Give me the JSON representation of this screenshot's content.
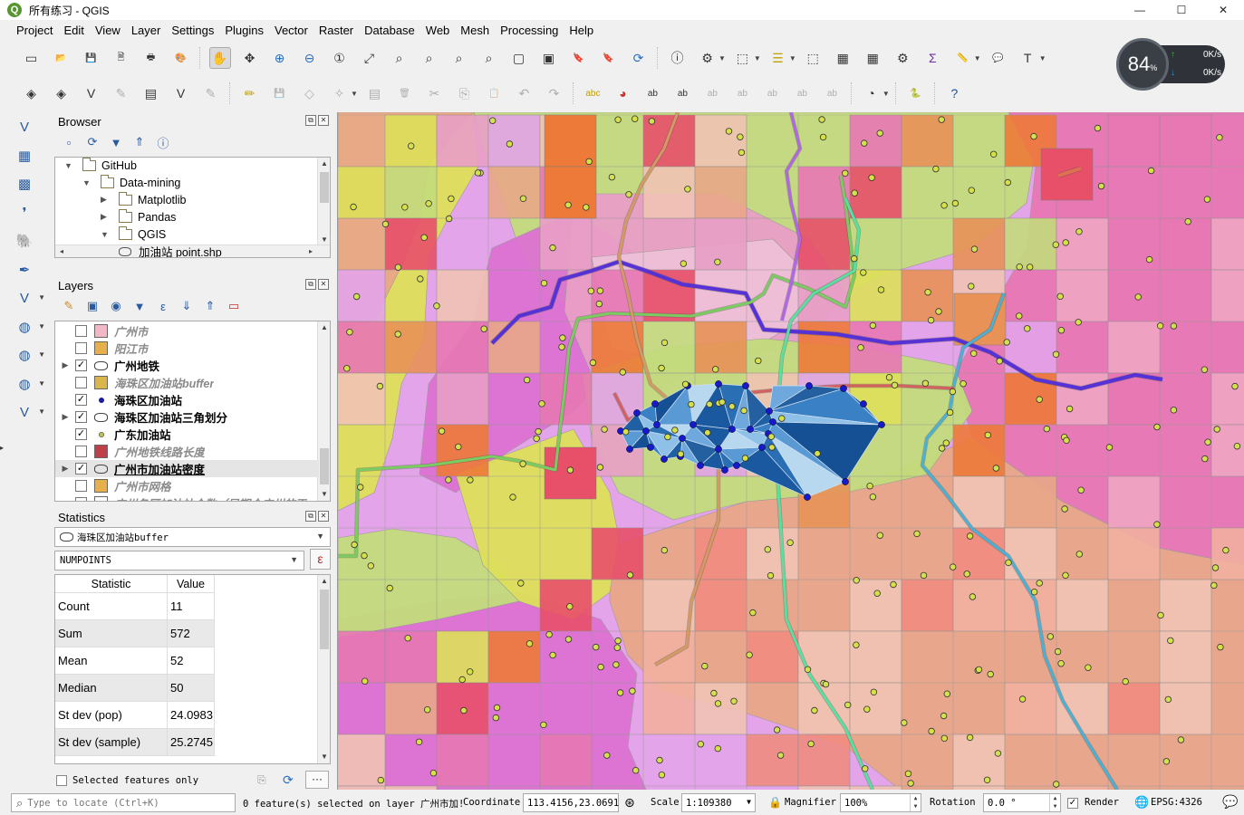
{
  "window": {
    "title": "所有练习 - QGIS",
    "app_icon": "Q",
    "controls": {
      "minimize": "—",
      "maximize": "☐",
      "close": "✕"
    }
  },
  "menubar": [
    "Project",
    "Edit",
    "View",
    "Layer",
    "Settings",
    "Plugins",
    "Vector",
    "Raster",
    "Database",
    "Web",
    "Mesh",
    "Processing",
    "Help"
  ],
  "toolbar1_icons": [
    "new-project-icon",
    "open-project-icon",
    "save-project-icon",
    "save-as-icon",
    "print-layout-icon",
    "style-manager-icon",
    "pan-icon",
    "pan-to-selection-icon",
    "zoom-in-icon",
    "zoom-out-icon",
    "zoom-native-icon",
    "zoom-full-icon",
    "zoom-to-selection-icon",
    "zoom-to-layer-icon",
    "zoom-last-icon",
    "zoom-next-icon",
    "new-map-view-icon",
    "new-3d-view-icon",
    "new-bookmark-icon",
    "show-bookmarks-icon",
    "refresh-icon",
    "identify-icon",
    "actions-icon",
    "select-features-icon",
    "select-by-value-icon",
    "deselect-icon",
    "attribute-table-icon",
    "field-calculator-icon",
    "processing-toolbox-icon",
    "statistical-summary-icon",
    "measure-icon",
    "map-tips-icon",
    "text-annotation-icon"
  ],
  "toolbar2_icons": [
    "data-source-manager-icon",
    "new-geopackage-icon",
    "new-shapefile-icon",
    "digitize-icon",
    "new-spatialite-icon",
    "new-virtual-layer-icon",
    "current-edits-icon",
    "toggle-editing-icon",
    "save-edits-icon",
    "add-feature-icon",
    "vertex-tool-icon",
    "modify-attributes-icon",
    "delete-selected-icon",
    "cut-features-icon",
    "copy-features-icon",
    "paste-features-icon",
    "undo-icon",
    "redo-icon",
    "label-icon",
    "layer-diagram-icon",
    "highlight-pinned-labels-icon",
    "pin-labels-icon",
    "show-hide-labels-icon",
    "preview-labels-icon",
    "move-labels-icon",
    "rotate-labels-icon",
    "change-label-icon",
    "heatmap-plugin-icon",
    "python-console-icon",
    "help-icon"
  ],
  "net_widget": {
    "percent": "84",
    "percent_unit": "%",
    "upload": "0K/s",
    "download": "0K/s",
    "up_arrow": "↑",
    "down_arrow": "↓"
  },
  "left_toolbar_icons": [
    "add-vector-layer-icon",
    "add-raster-layer-icon",
    "add-mesh-layer-icon",
    "add-delimited-text-icon",
    "add-postgis-icon",
    "add-spatialite-icon",
    "add-mssql-icon",
    "add-wms-icon",
    "add-wfs-icon",
    "add-wcs-icon",
    "add-virtual-layer-icon"
  ],
  "browser": {
    "title": "Browser",
    "tree": [
      {
        "label": "GitHub",
        "level": 1,
        "expanded": true,
        "type": "folder"
      },
      {
        "label": "Data-mining",
        "level": 2,
        "expanded": true,
        "type": "folder"
      },
      {
        "label": "Matplotlib",
        "level": 3,
        "expanded": false,
        "type": "folder"
      },
      {
        "label": "Pandas",
        "level": 3,
        "expanded": false,
        "type": "folder"
      },
      {
        "label": "QGIS",
        "level": 3,
        "expanded": true,
        "type": "folder"
      },
      {
        "label": "加油站 point.shp",
        "level": 4,
        "type": "shp"
      }
    ]
  },
  "layers": {
    "title": "Layers",
    "items": [
      {
        "label": "广州市",
        "checked": false,
        "visible_style": "off",
        "symbol_color": "#f2b8c6",
        "symbol": "box",
        "expandable": false
      },
      {
        "label": "阳江市",
        "checked": false,
        "visible_style": "off",
        "symbol_color": "#e8b04a",
        "symbol": "box",
        "expandable": false
      },
      {
        "label": "广州地铁",
        "checked": true,
        "visible_style": "on",
        "symbol": "group",
        "expandable": true
      },
      {
        "label": "海珠区加油站buffer",
        "checked": false,
        "visible_style": "off",
        "symbol_color": "#d9b54a",
        "symbol": "box",
        "expandable": false
      },
      {
        "label": "海珠区加油站",
        "checked": true,
        "visible_style": "on",
        "symbol_color": "#1a1aa0",
        "symbol": "dot",
        "expandable": false
      },
      {
        "label": "海珠区加油站三角划分",
        "checked": true,
        "visible_style": "on",
        "symbol": "group",
        "expandable": true
      },
      {
        "label": "广东加油站",
        "checked": true,
        "visible_style": "on",
        "symbol_color": "#c8c83a",
        "symbol": "dot",
        "expandable": false
      },
      {
        "label": "广州地铁线路长度",
        "checked": false,
        "visible_style": "off",
        "symbol_color": "#c0404a",
        "symbol": "box",
        "expandable": false
      },
      {
        "label": "广州市加油站密度",
        "checked": true,
        "visible_style": "selected",
        "symbol": "group",
        "expandable": true
      },
      {
        "label": "广州市网格",
        "checked": false,
        "visible_style": "off",
        "symbol_color": "#e8b04a",
        "symbol": "box",
        "expandable": false
      },
      {
        "label": "广州各区加油站个数（早期个广州的面",
        "checked": false,
        "visible_style": "off",
        "symbol": "box",
        "symbol_color": "#ffffff",
        "expandable": false
      }
    ]
  },
  "statistics": {
    "title": "Statistics",
    "layer": "海珠区加油站buffer",
    "field": "NUMPOINTS",
    "expr_symbol": "ε",
    "columns": [
      "Statistic",
      "Value"
    ],
    "rows": [
      {
        "name": "Count",
        "value": "11"
      },
      {
        "name": "Sum",
        "value": "572"
      },
      {
        "name": "Mean",
        "value": "52"
      },
      {
        "name": "Median",
        "value": "50"
      },
      {
        "name": "St dev (pop)",
        "value": "24.0983"
      },
      {
        "name": "St dev (sample)",
        "value": "25.2745"
      }
    ],
    "selected_only_label": "Selected features only",
    "more": "···"
  },
  "statusbar": {
    "locator_placeholder": "Type to locate (Ctrl+K)",
    "message": "0 feature(s) selected on layer 广州市加!",
    "coordinate_label": "Coordinate",
    "coordinate": "113.4156,23.0691",
    "scale_label": "Scale",
    "scale": "1:109380",
    "magnifier_label": "Magnifier",
    "magnifier": "100%",
    "rotation_label": "Rotation",
    "rotation": "0.0 °",
    "render_label": "Render",
    "crs": "EPSG:4326"
  },
  "map_colors": {
    "yellow": "#dee05a",
    "lightgreen": "#c3dc7c",
    "pink": "#e99fc6",
    "magenta": "#dd72d2",
    "lilac": "#e4a4e9",
    "salmon": "#e9a889",
    "peach": "#f1c3b4",
    "orange": "#e89258",
    "deeporange": "#ee7a3a",
    "red": "#e8506a",
    "hotpink": "#e878b4",
    "metro_purple": "#5531d6",
    "metro_green": "#7acc60",
    "metro_brown": "#d49a64",
    "metro_teal": "#4ab0d4",
    "metro_mint": "#58e0a0",
    "metro_violet": "#b266e6",
    "metro_olive": "#84bc38",
    "metro_red": "#d46060",
    "tin_dark": "#1f5fa4",
    "tin_light": "#8ec0e8",
    "point_fill": "#d6e04a",
    "vertex_fill": "#1818cc"
  }
}
